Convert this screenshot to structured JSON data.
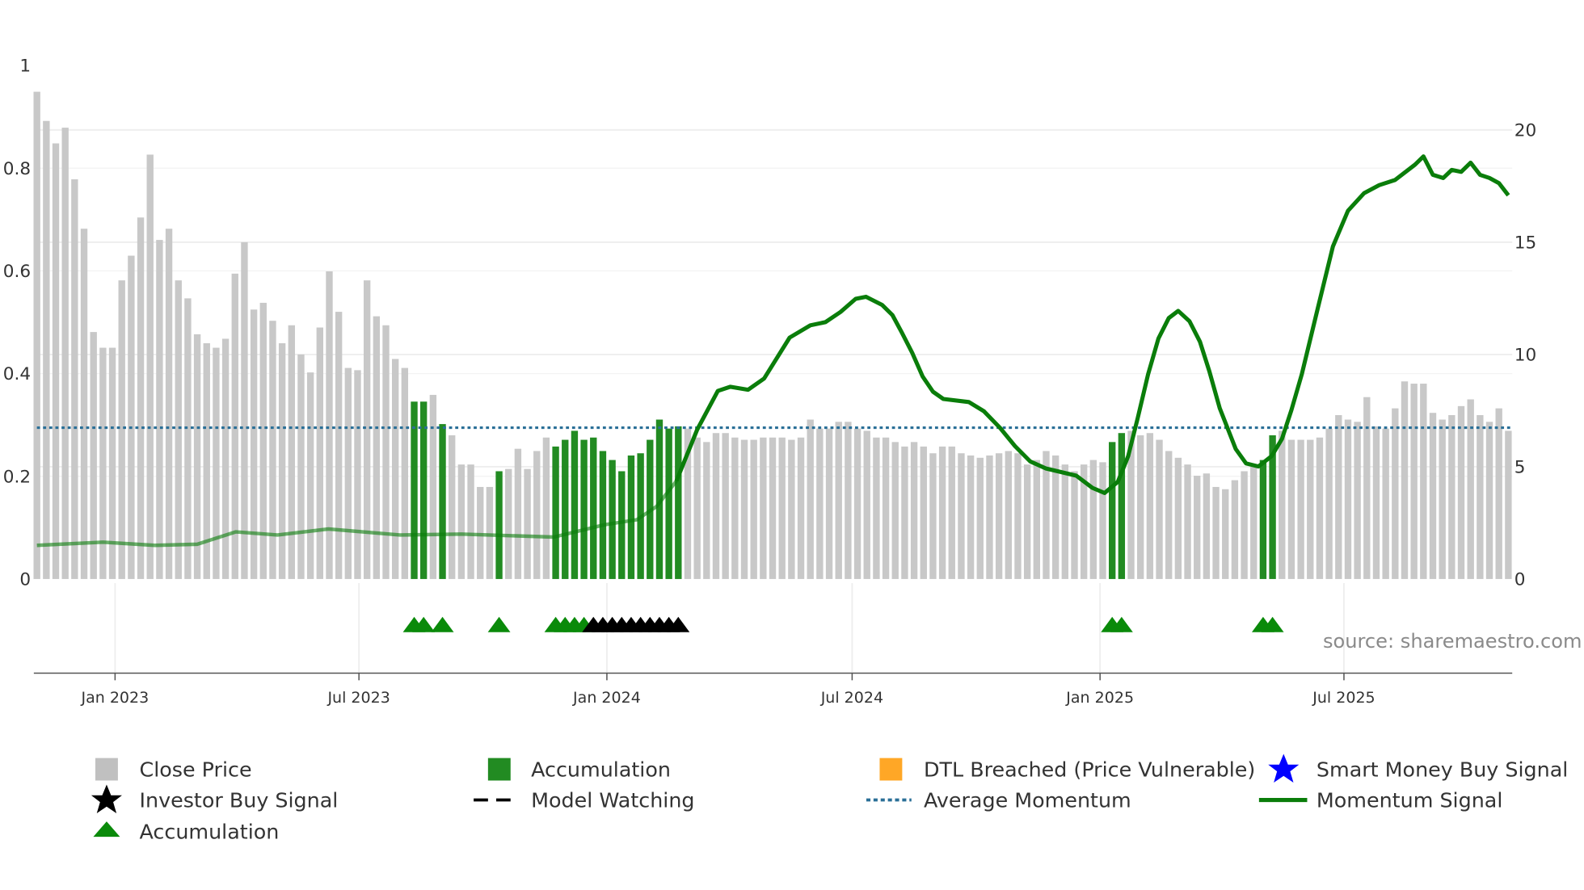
{
  "chart_data": {
    "type": "bar",
    "title": "",
    "source": "source: sharemaestro.com",
    "x_axis": {
      "start_date": "2022-11-04",
      "interval_days": 7,
      "ticks": [
        {
          "date": "2023-01-01",
          "label": "Jan 2023"
        },
        {
          "date": "2023-07-01",
          "label": "Jul 2023"
        },
        {
          "date": "2024-01-01",
          "label": "Jan 2024"
        },
        {
          "date": "2024-07-01",
          "label": "Jul 2024"
        },
        {
          "date": "2025-01-01",
          "label": "Jan 2025"
        },
        {
          "date": "2025-07-01",
          "label": "Jul 2025"
        }
      ]
    },
    "left_axis": {
      "ylim": [
        0,
        1
      ],
      "ticks": [
        "0",
        "0.2",
        "0.4",
        "0.6",
        "0.8",
        "1"
      ]
    },
    "right_axis": {
      "ylim": [
        0,
        22.9
      ],
      "ticks": [
        "0",
        "5",
        "10",
        "15",
        "20"
      ]
    },
    "close_price": [
      21.7,
      20.4,
      19.4,
      20.1,
      17.8,
      15.6,
      11.0,
      10.3,
      10.3,
      13.3,
      14.4,
      16.1,
      18.9,
      15.1,
      15.6,
      13.3,
      12.5,
      10.9,
      10.5,
      10.3,
      10.7,
      13.6,
      15.0,
      12.0,
      12.3,
      11.5,
      10.5,
      11.3,
      10.0,
      9.2,
      11.2,
      13.7,
      11.9,
      9.4,
      9.3,
      13.3,
      11.7,
      11.3,
      9.8,
      9.4,
      7.9,
      7.9,
      8.2,
      6.9,
      6.4,
      5.1,
      5.1,
      4.1,
      4.1,
      4.8,
      4.9,
      5.8,
      4.9,
      5.7,
      6.3,
      5.9,
      6.2,
      6.6,
      6.2,
      6.3,
      5.7,
      5.3,
      4.8,
      5.5,
      5.6,
      6.2,
      7.1,
      6.7,
      6.8,
      6.7,
      6.3,
      6.1,
      6.5,
      6.5,
      6.3,
      6.2,
      6.2,
      6.3,
      6.3,
      6.3,
      6.2,
      6.3,
      7.1,
      6.7,
      6.7,
      7.0,
      7.0,
      6.7,
      6.6,
      6.3,
      6.3,
      6.1,
      5.9,
      6.1,
      5.9,
      5.6,
      5.9,
      5.9,
      5.6,
      5.5,
      5.4,
      5.5,
      5.6,
      5.7,
      5.6,
      5.1,
      5.3,
      5.7,
      5.5,
      5.1,
      4.8,
      5.1,
      5.3,
      5.2,
      6.1,
      6.5,
      6.6,
      6.4,
      6.5,
      6.2,
      5.7,
      5.4,
      5.1,
      4.6,
      4.7,
      4.1,
      4.0,
      4.4,
      4.8,
      5.0,
      5.3,
      6.4,
      6.6,
      6.2,
      6.2,
      6.2,
      6.3,
      6.7,
      7.3,
      7.1,
      7.0,
      8.1,
      6.8,
      6.7,
      7.6,
      8.8,
      8.7,
      8.7,
      7.4,
      7.1,
      7.3,
      7.7,
      8.0,
      7.3,
      7.0,
      7.6,
      6.6
    ],
    "accumulation_bar_indices": [
      40,
      41,
      43,
      49,
      55,
      56,
      57,
      58,
      59,
      60,
      61,
      62,
      63,
      64,
      65,
      66,
      67,
      68,
      114,
      115,
      130,
      131
    ],
    "momentum_signal": [
      [
        0,
        1.5
      ],
      [
        7,
        1.64
      ],
      [
        12.5,
        1.5
      ],
      [
        17,
        1.55
      ],
      [
        21.1,
        2.1
      ],
      [
        25.5,
        1.96
      ],
      [
        30.9,
        2.23
      ],
      [
        38.5,
        1.96
      ],
      [
        45,
        2.0
      ],
      [
        54.8,
        1.87
      ],
      [
        60.2,
        2.42
      ],
      [
        63.6,
        2.64
      ],
      [
        65.7,
        3.23
      ],
      [
        67.8,
        4.37
      ],
      [
        70,
        6.65
      ],
      [
        72.2,
        8.38
      ],
      [
        73.5,
        8.56
      ],
      [
        75.4,
        8.43
      ],
      [
        77.1,
        8.93
      ],
      [
        79.8,
        10.75
      ],
      [
        82,
        11.3
      ],
      [
        83.6,
        11.44
      ],
      [
        85.2,
        11.89
      ],
      [
        86.8,
        12.48
      ],
      [
        87.9,
        12.57
      ],
      [
        89.6,
        12.21
      ],
      [
        90.7,
        11.76
      ],
      [
        91.7,
        10.98
      ],
      [
        92.8,
        10.07
      ],
      [
        93.9,
        9.02
      ],
      [
        95,
        8.34
      ],
      [
        96.1,
        8.02
      ],
      [
        98.8,
        7.88
      ],
      [
        100.4,
        7.47
      ],
      [
        102.1,
        6.74
      ],
      [
        103.7,
        5.92
      ],
      [
        105.3,
        5.24
      ],
      [
        107,
        4.92
      ],
      [
        110.2,
        4.6
      ],
      [
        111.9,
        4.06
      ],
      [
        113.2,
        3.83
      ],
      [
        114.6,
        4.33
      ],
      [
        115.7,
        5.47
      ],
      [
        116.7,
        7.15
      ],
      [
        117.8,
        9.11
      ],
      [
        118.9,
        10.71
      ],
      [
        120,
        11.62
      ],
      [
        121,
        11.94
      ],
      [
        122.2,
        11.48
      ],
      [
        123.3,
        10.57
      ],
      [
        124.3,
        9.25
      ],
      [
        125.4,
        7.61
      ],
      [
        127.1,
        5.79
      ],
      [
        128.2,
        5.15
      ],
      [
        129.5,
        5.01
      ],
      [
        130.9,
        5.47
      ],
      [
        132,
        6.24
      ],
      [
        133,
        7.52
      ],
      [
        134.1,
        9.11
      ],
      [
        135.8,
        12.07
      ],
      [
        137.4,
        14.81
      ],
      [
        139,
        16.4
      ],
      [
        140.7,
        17.18
      ],
      [
        142.3,
        17.54
      ],
      [
        144,
        17.77
      ],
      [
        146.1,
        18.45
      ],
      [
        147,
        18.82
      ],
      [
        148,
        18.0
      ],
      [
        149.1,
        17.86
      ],
      [
        150,
        18.22
      ],
      [
        151,
        18.13
      ],
      [
        152,
        18.54
      ],
      [
        153,
        18.0
      ],
      [
        154,
        17.86
      ],
      [
        155,
        17.63
      ],
      [
        156,
        17.09
      ]
    ],
    "momentum_faded_until_index": 68,
    "average_momentum": 6.74,
    "accumulation_markers": [
      40,
      41,
      43,
      49,
      55,
      56,
      57,
      58,
      114,
      115,
      130,
      131
    ],
    "investor_buy_markers": [
      59,
      60,
      61,
      62,
      63,
      64,
      65,
      66,
      67,
      68
    ],
    "colors": {
      "close_price": "#c8c8c8",
      "accumulation": "#228b22",
      "dtl": "#ffa726",
      "smart_money": "#0000ff",
      "momentum": "#0a7d0a",
      "average": "#2a6f97",
      "marker_green": "#0a8a0a",
      "marker_black": "#000000"
    },
    "legend": [
      {
        "label": "Close Price",
        "icon": "gray-square"
      },
      {
        "label": "Accumulation",
        "icon": "green-square"
      },
      {
        "label": "DTL Breached (Price Vulnerable)",
        "icon": "orange-square"
      },
      {
        "label": "Smart Money Buy Signal",
        "icon": "blue-star"
      },
      {
        "label": "Investor Buy Signal",
        "icon": "black-star"
      },
      {
        "label": "Model Watching",
        "icon": "black-dash"
      },
      {
        "label": "Average Momentum",
        "icon": "blue-dotted"
      },
      {
        "label": "Momentum Signal",
        "icon": "green-line"
      },
      {
        "label": "Accumulation",
        "icon": "green-triangle"
      }
    ]
  }
}
